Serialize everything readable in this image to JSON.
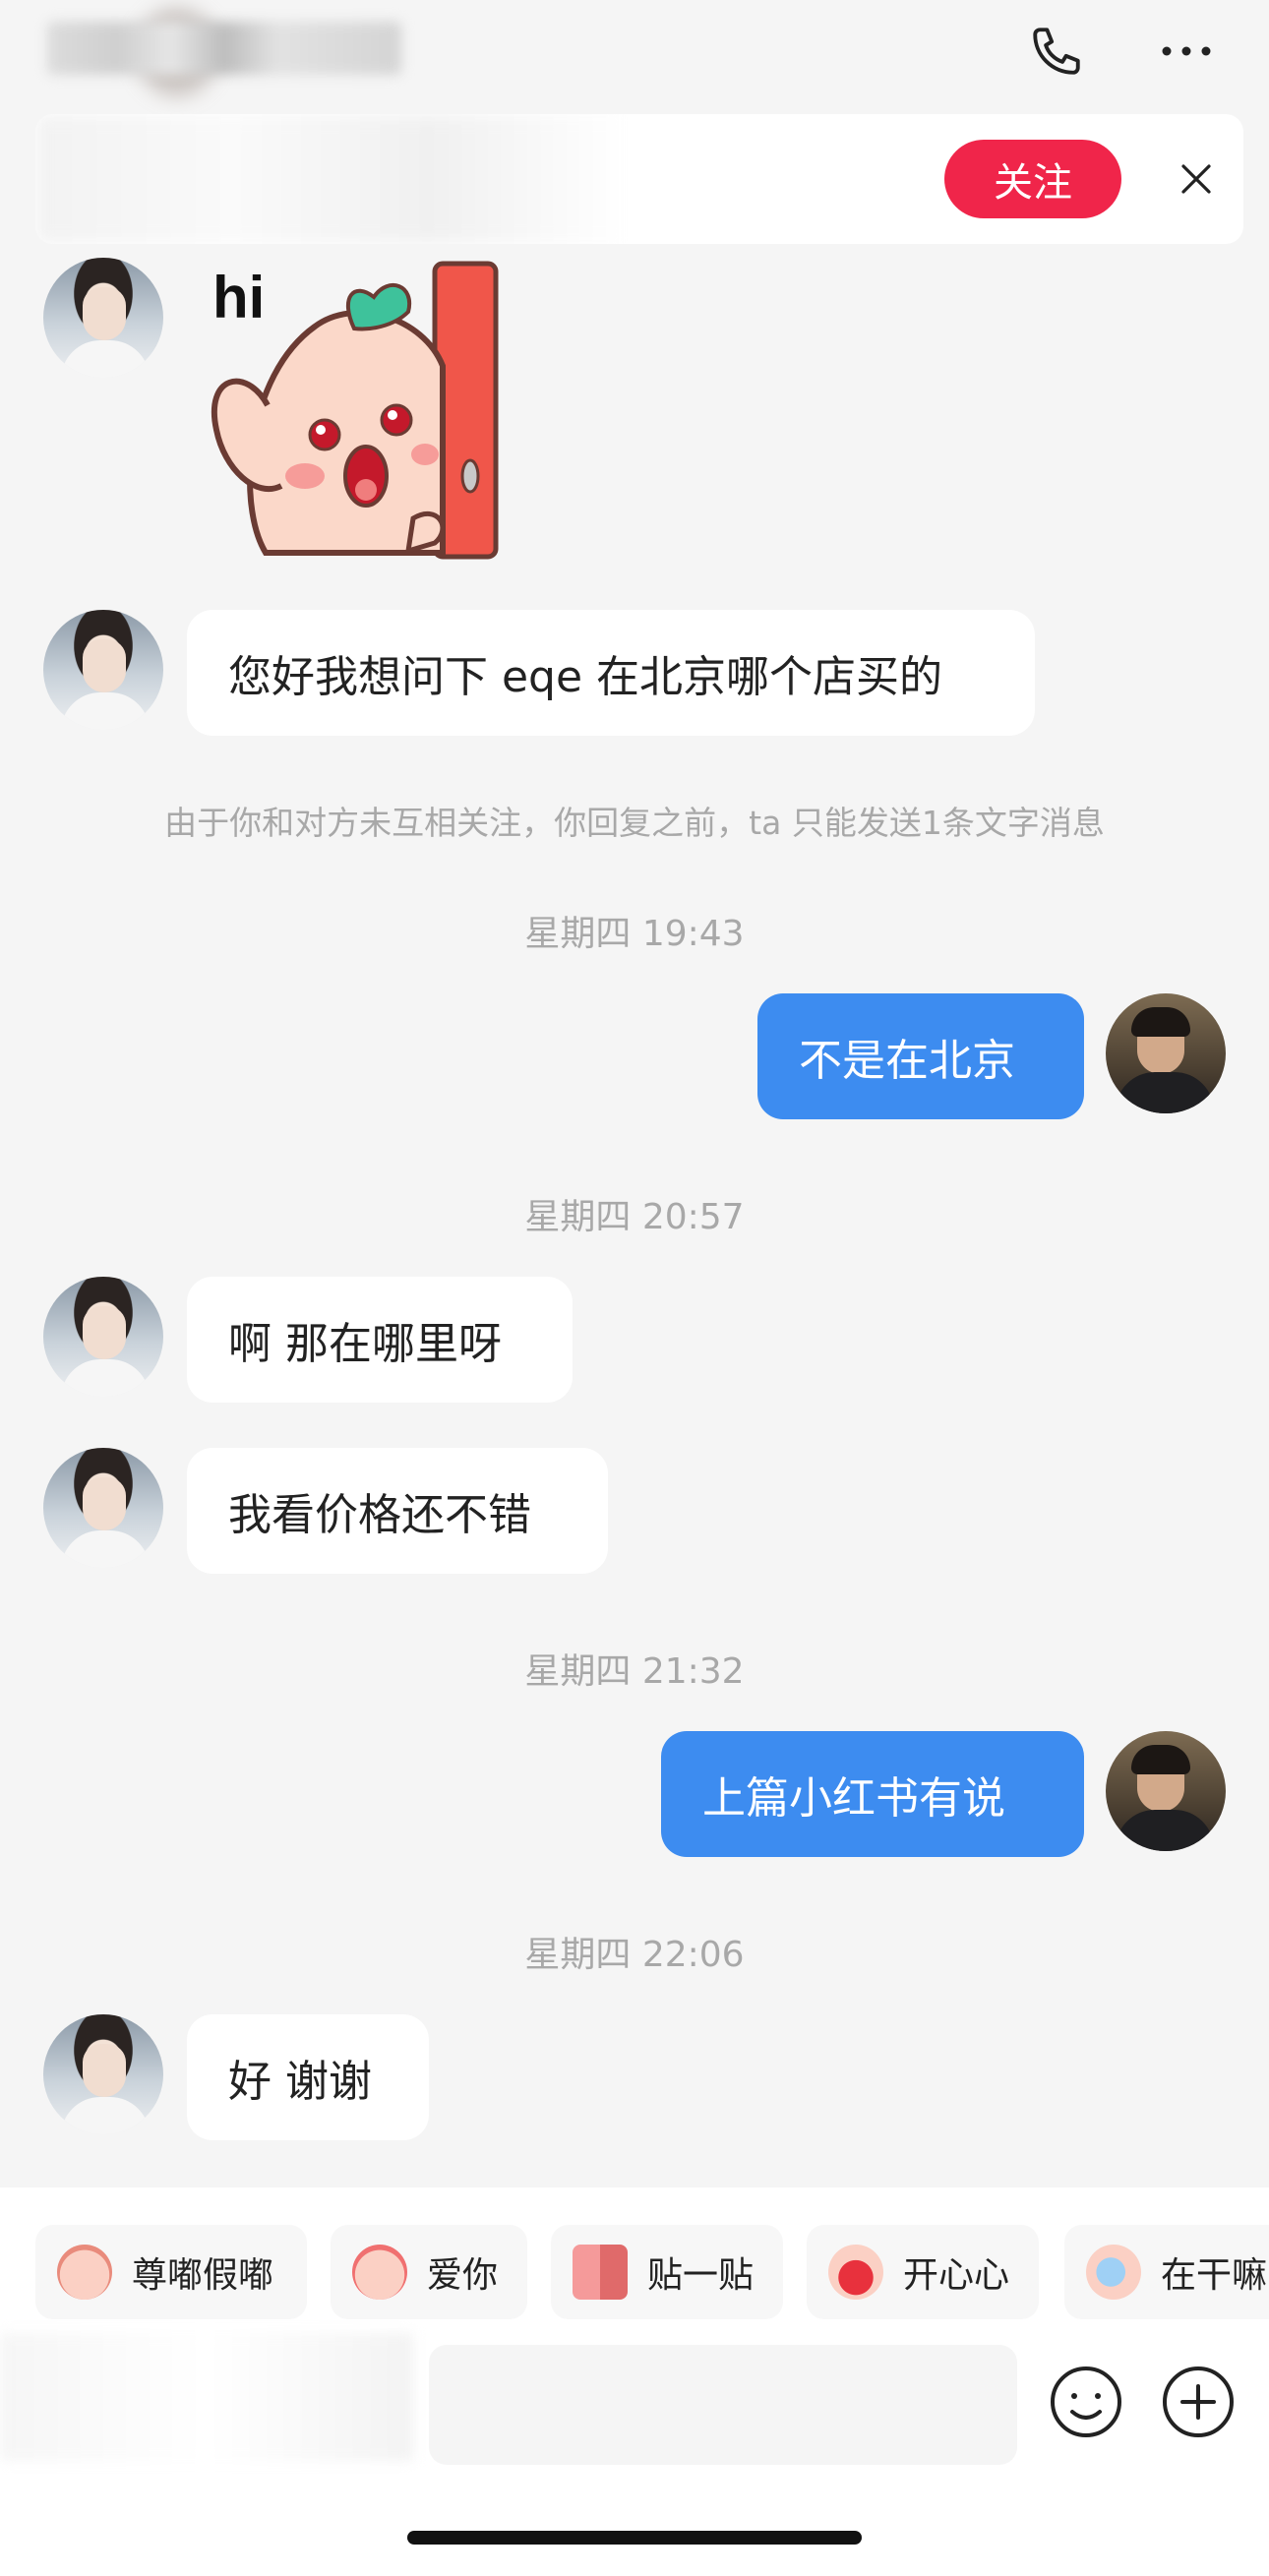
{
  "header": {
    "call_icon": "phone-icon",
    "more_icon": "more-horizontal-icon"
  },
  "banner": {
    "follow_label": "关注",
    "close_icon": "close-icon"
  },
  "messages": {
    "sticker_text": "hi",
    "m1": "您好我想问下 eqe 在北京哪个店买的",
    "notice": "由于你和对方未互相关注，你回复之前，ta 只能发送1条文字消息",
    "ts1": "星期四 19:43",
    "m2": "不是在北京",
    "ts2": "星期四 20:57",
    "m3": "啊 那在哪里呀",
    "m4": "我看价格还不错",
    "ts3": "星期四 21:32",
    "m5": "上篇小红书有说",
    "ts4": "星期四 22:06",
    "m6": "好 谢谢"
  },
  "quick_replies": [
    {
      "label": "尊嘟假嘟",
      "icon": "pig-sticker-icon"
    },
    {
      "label": "爱你",
      "icon": "pig-heart-sticker-icon"
    },
    {
      "label": "贴一贴",
      "icon": "hug-sticker-icon"
    },
    {
      "label": "开心心",
      "icon": "happy-sticker-icon"
    },
    {
      "label": "在干嘛",
      "icon": "peek-sticker-icon"
    }
  ],
  "composer": {
    "emoji_icon": "emoji-icon",
    "plus_icon": "plus-circle-icon"
  },
  "colors": {
    "accent_blue": "#3d8cf0",
    "follow_red": "#f0254a"
  }
}
